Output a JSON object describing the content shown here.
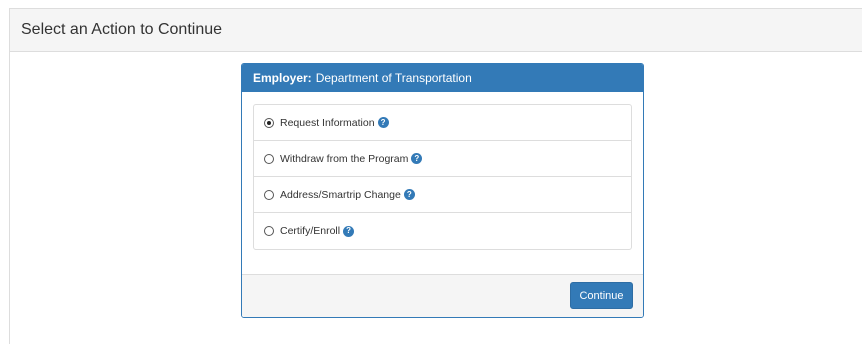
{
  "page": {
    "heading": "Select an Action to Continue"
  },
  "card": {
    "employer_label": "Employer:",
    "employer_name": "Department of Transportation",
    "options": [
      {
        "label": "Request Information",
        "selected": true,
        "help_icon": "question-circle-icon"
      },
      {
        "label": "Withdraw from the Program",
        "selected": false,
        "help_icon": "question-circle-icon"
      },
      {
        "label": "Address/Smartrip Change",
        "selected": false,
        "help_icon": "question-circle-icon"
      },
      {
        "label": "Certify/Enroll",
        "selected": false,
        "help_icon": "question-circle-icon"
      }
    ],
    "continue_label": "Continue"
  },
  "colors": {
    "primary": "#337ab7",
    "panel_bg": "#f5f5f5",
    "border": "#dddddd"
  }
}
